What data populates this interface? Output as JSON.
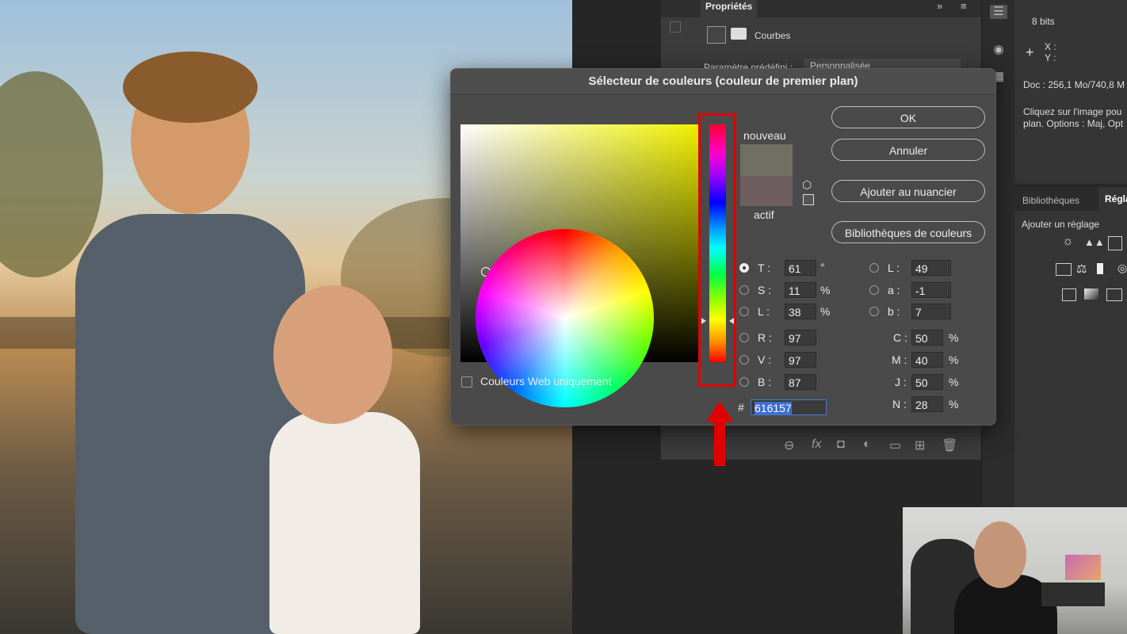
{
  "panel": {
    "tab_title": "Propriétés",
    "adjustment_label": "Courbes",
    "preset_label": "Paramètre prédéfini :",
    "preset_value": "Personnalisée"
  },
  "info": {
    "bits": "8 bits",
    "x_label": "X :",
    "y_label": "Y :",
    "doc": "Doc : 256,1 Mo/740,8 M",
    "hint_line1": "Cliquez sur l'image pou",
    "hint_line2": "plan. Options : Maj, Opt"
  },
  "libraries": {
    "tab1": "Bibliothèques",
    "tab2": "Régla",
    "add_label": "Ajouter un réglage"
  },
  "dialog": {
    "title": "Sélecteur de couleurs (couleur de premier plan)",
    "nouveau": "nouveau",
    "actif": "actif",
    "web_colors_label": "Couleurs Web uniquement",
    "buttons": {
      "ok": "OK",
      "cancel": "Annuler",
      "add_swatch": "Ajouter au nuancier",
      "color_libraries": "Bibliothèques de couleurs"
    },
    "fields": {
      "T": {
        "label": "T :",
        "value": "61",
        "unit": "°"
      },
      "S": {
        "label": "S :",
        "value": "11",
        "unit": "%"
      },
      "L_hsl": {
        "label": "L :",
        "value": "38",
        "unit": "%"
      },
      "R": {
        "label": "R :",
        "value": "97"
      },
      "V": {
        "label": "V :",
        "value": "97"
      },
      "B": {
        "label": "B :",
        "value": "87"
      },
      "L_lab": {
        "label": "L :",
        "value": "49"
      },
      "a": {
        "label": "a :",
        "value": "-1"
      },
      "b": {
        "label": "b :",
        "value": "7"
      },
      "C": {
        "label": "C :",
        "value": "50",
        "unit": "%"
      },
      "M": {
        "label": "M :",
        "value": "40",
        "unit": "%"
      },
      "J": {
        "label": "J :",
        "value": "50",
        "unit": "%"
      },
      "N": {
        "label": "N :",
        "value": "28",
        "unit": "%"
      },
      "hex_label": "#",
      "hex": "616157"
    },
    "swatch_new": "#6f6f63",
    "swatch_current": "#6e5e60"
  },
  "colors": {
    "highlight": "#e10000",
    "dialog_bg": "#4a4a4a",
    "panel_bg": "#3c3c3c"
  }
}
